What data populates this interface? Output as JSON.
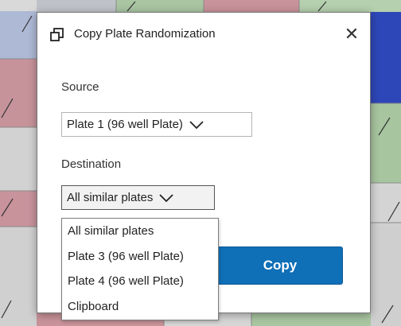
{
  "dialog": {
    "title": "Copy Plate Randomization",
    "close_label": "✕",
    "source_label": "Source",
    "source_value": "Plate 1 (96 well Plate)",
    "destination_label": "Destination",
    "destination_value": "All similar plates",
    "copy_label": "Copy"
  },
  "dropdown": {
    "options": [
      "All similar plates",
      "Plate 3 (96 well Plate)",
      "Plate 4 (96 well Plate)",
      "Clipboard"
    ]
  },
  "colors": {
    "accent": "#0f6fb7",
    "plate_red": "#c9939a",
    "plate_green": "#a8c6a0",
    "plate_gray": "#d6d6d6",
    "plate_blue": "#2e47b8"
  },
  "icons": {
    "title_icon": "copy-icon",
    "close": "close-icon",
    "chevron": "chevron-down-icon"
  }
}
